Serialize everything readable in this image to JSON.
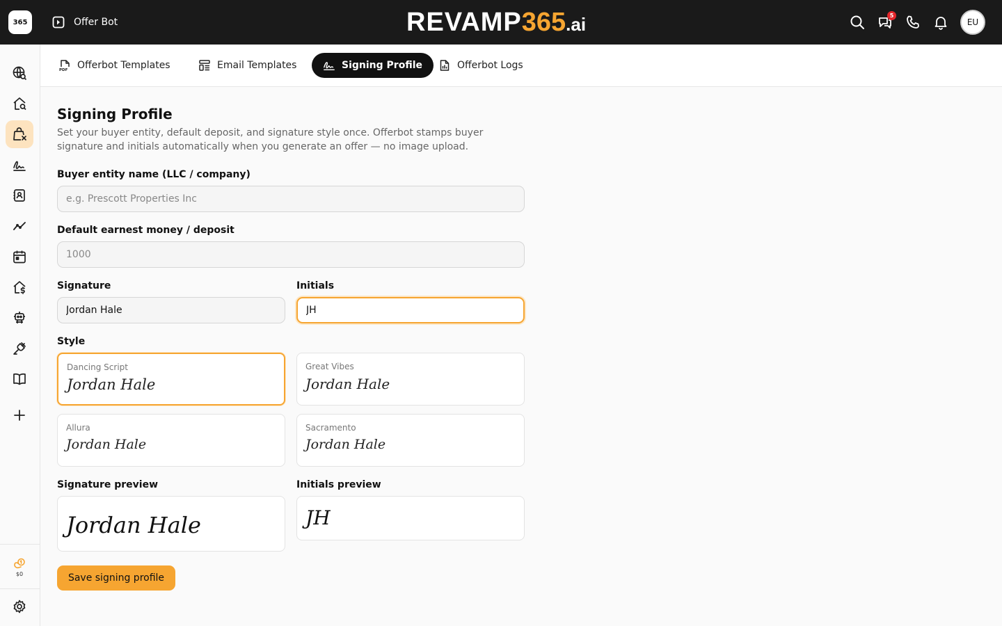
{
  "header": {
    "app_title": "Offer Bot",
    "logo_text": "365",
    "brand_main": "REVAMP",
    "brand_num": "365",
    "brand_suffix": ".ai",
    "notification_count": "5",
    "avatar_initials": "EU",
    "accent_color": "#f6a531"
  },
  "sidebar": {
    "items": [
      {
        "icon": "globe-search-icon"
      },
      {
        "icon": "home-search-icon"
      },
      {
        "icon": "shopping-bag-icon",
        "active": true
      },
      {
        "icon": "signature-icon"
      },
      {
        "icon": "contacts-book-icon"
      },
      {
        "icon": "trend-line-icon"
      },
      {
        "icon": "calendar-icon"
      },
      {
        "icon": "home-dollar-icon"
      },
      {
        "icon": "robot-icon"
      },
      {
        "icon": "plug-icon"
      },
      {
        "icon": "book-icon"
      },
      {
        "icon": "plus-icon"
      }
    ],
    "credits_label": "$0"
  },
  "tabs": [
    {
      "label": "Offerbot Templates",
      "icon": "pdf-file-icon"
    },
    {
      "label": "Email Templates",
      "icon": "template-icon"
    },
    {
      "label": "Signing Profile",
      "icon": "signature-icon",
      "active": true
    },
    {
      "label": "Offerbot Logs",
      "icon": "log-file-icon"
    }
  ],
  "form": {
    "title": "Signing Profile",
    "description": "Set your buyer entity, default deposit, and signature style once. Offerbot stamps buyer signature and initials automatically when you generate an offer — no image upload.",
    "entity_label": "Buyer entity name (LLC / company)",
    "entity_placeholder": "e.g. Prescott Properties Inc",
    "entity_value": "",
    "deposit_label": "Default earnest money / deposit",
    "deposit_placeholder": "1000",
    "deposit_value": "",
    "signature_label": "Signature",
    "signature_value": "Jordan Hale",
    "initials_label": "Initials",
    "initials_value": "JH",
    "style_label": "Style",
    "styles": [
      {
        "name": "Dancing Script",
        "sample": "Jordan Hale",
        "selected": true
      },
      {
        "name": "Great Vibes",
        "sample": "Jordan Hale"
      },
      {
        "name": "Allura",
        "sample": "Jordan Hale"
      },
      {
        "name": "Sacramento",
        "sample": "Jordan Hale"
      }
    ],
    "signature_preview_label": "Signature preview",
    "signature_preview_text": "Jordan Hale",
    "initials_preview_label": "Initials preview",
    "initials_preview_text": "JH",
    "save_label": "Save signing profile"
  }
}
